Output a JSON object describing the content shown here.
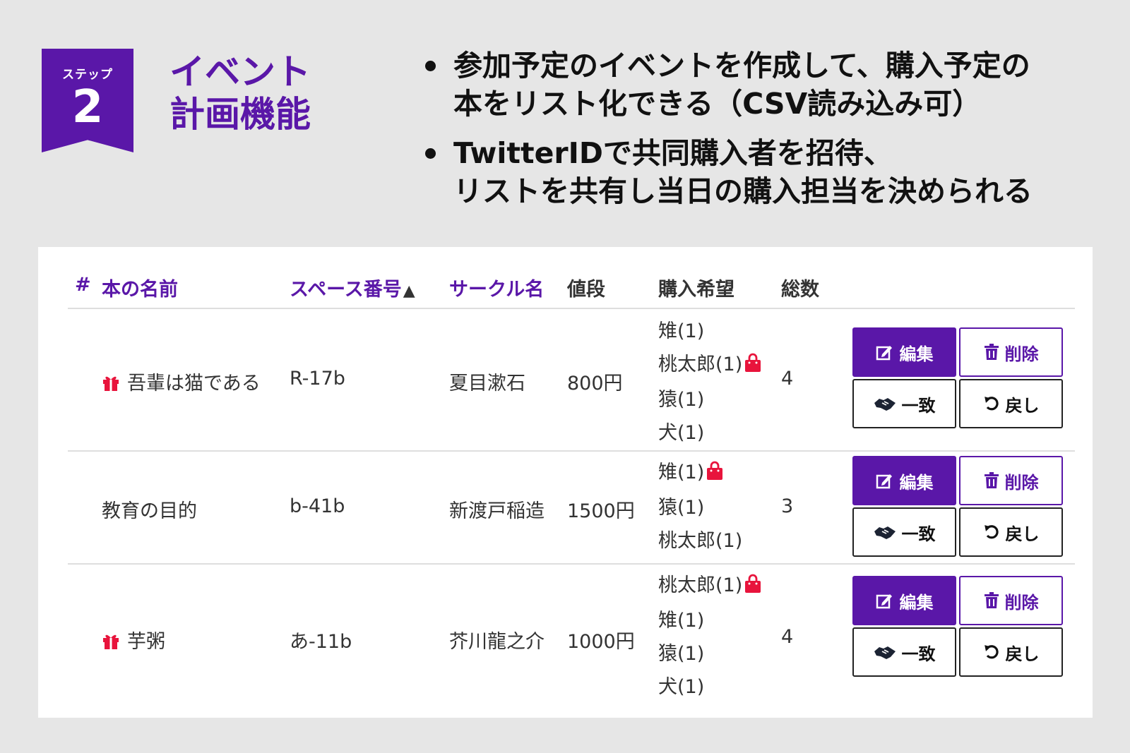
{
  "header": {
    "step_label": "ステップ",
    "step_number": "2",
    "title_line1": "イベント",
    "title_line2": "計画機能",
    "bullets": [
      {
        "line1": "参加予定のイベントを作成して、購入予定の",
        "line2": "本をリスト化できる（CSV読み込み可）"
      },
      {
        "line1": "TwitterIDで共同購入者を招待、",
        "line2": "リストを共有し当日の購入担当を決められる"
      }
    ]
  },
  "table": {
    "headers": {
      "index": "#",
      "book_name": "本の名前",
      "space": "スペース番号",
      "sort_indicator": "▲",
      "circle": "サークル名",
      "price": "値段",
      "wishes": "購入希望",
      "total": "総数"
    },
    "rows": [
      {
        "gift": true,
        "book": "吾輩は猫である",
        "space": "R-17b",
        "circle": "夏目漱石",
        "price": "800円",
        "wishes": [
          "雉(1)",
          "桃太郎(1)",
          "猿(1)",
          "犬(1)"
        ],
        "buyer_index": 1,
        "total": "4"
      },
      {
        "gift": false,
        "book": "教育の目的",
        "space": "b-41b",
        "circle": "新渡戸稲造",
        "price": "1500円",
        "wishes": [
          "雉(1)",
          "猿(1)",
          "桃太郎(1)"
        ],
        "buyer_index": 0,
        "total": "3"
      },
      {
        "gift": true,
        "book": "芋粥",
        "space": "あ-11b",
        "circle": "芥川龍之介",
        "price": "1000円",
        "wishes": [
          "桃太郎(1)",
          "雉(1)",
          "猿(1)",
          "犬(1)"
        ],
        "buyer_index": 0,
        "total": "4"
      }
    ],
    "buttons": {
      "edit": "編集",
      "delete": "削除",
      "match": "一致",
      "undo": "戻し"
    }
  },
  "colors": {
    "brand": "#5a17a8",
    "accent_red": "#e8143c",
    "background": "#e6e6e6"
  },
  "icons": {
    "gift": "gift-icon",
    "bag": "shopping-bag-icon",
    "edit": "edit-icon",
    "delete": "trash-icon",
    "match": "handshake-icon",
    "undo": "undo-icon"
  }
}
